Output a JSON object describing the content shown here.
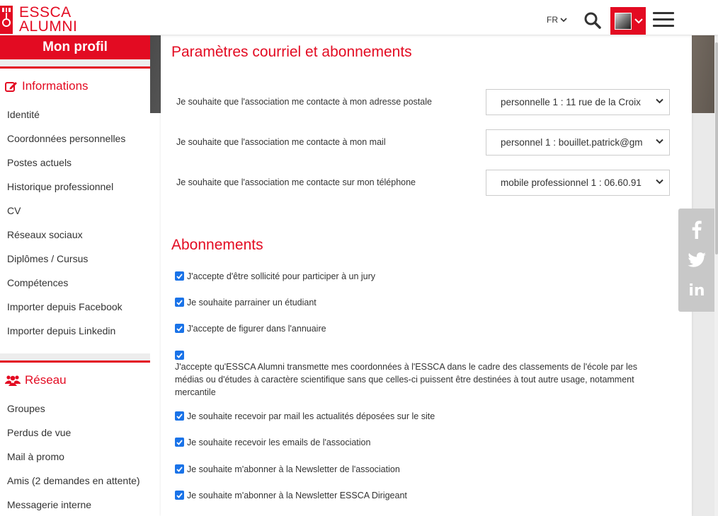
{
  "header": {
    "logo_line1": "ESSCA",
    "logo_line2": "ALUMNI",
    "language": "FR"
  },
  "sidebar": {
    "profile_button": "Mon profil",
    "informations_title": "Informations",
    "informations_items": [
      "Identité",
      "Coordonnées personnelles",
      "Postes actuels",
      "Historique professionnel",
      "CV",
      "Réseaux sociaux",
      "Diplômes / Cursus",
      "Compétences",
      "Importer depuis Facebook",
      "Importer depuis Linkedin"
    ],
    "reseau_title": "Réseau",
    "reseau_items": [
      "Groupes",
      "Perdus de vue",
      "Mail à promo",
      "Amis (2 demandes en attente)",
      "Messagerie interne"
    ]
  },
  "main": {
    "title": "Paramètres courriel et abonnements",
    "contact_prefs": [
      {
        "label": "Je souhaite que l'association me contacte à mon adresse postale",
        "value": "personnelle 1 : 11 rue de la Croix"
      },
      {
        "label": "Je souhaite que l'association me contacte à mon mail",
        "value": "personnel 1 : bouillet.patrick@gm"
      },
      {
        "label": "Je souhaite que l'association me contacte sur mon téléphone",
        "value": "mobile professionnel 1 : 06.60.91"
      }
    ],
    "subscriptions_title": "Abonnements",
    "checkboxes": [
      {
        "label": "J'accepte d'être sollicité pour participer à un jury",
        "checked": true
      },
      {
        "label": "Je souhaite parrainer un étudiant",
        "checked": true
      },
      {
        "label": "J'accepte de figurer dans l'annuaire",
        "checked": true
      },
      {
        "label": "J'accepte qu'ESSCA Alumni transmette mes coordonnées à l'ESSCA dans le cadre des classements de l'école par les médias ou d'études à caractère scientifique sans que celles-ci puissent être destinées à tout autre usage, notamment mercantile",
        "checked": true
      },
      {
        "label": "Je souhaite recevoir par mail les actualités déposées sur le site",
        "checked": true
      },
      {
        "label": "Je souhaite recevoir les emails de l'association",
        "checked": true
      },
      {
        "label": "Je souhaite m'abonner à la Newsletter de l'association",
        "checked": true
      },
      {
        "label": "Je souhaite m'abonner à la Newsletter ESSCA Dirigeant",
        "checked": true
      }
    ]
  },
  "social": {
    "icons": [
      "facebook-icon",
      "twitter-icon",
      "linkedin-icon"
    ],
    "linkedin_text": "in"
  },
  "colors": {
    "brand_red": "#e30b22",
    "checkbox_blue": "#1a73e8"
  }
}
